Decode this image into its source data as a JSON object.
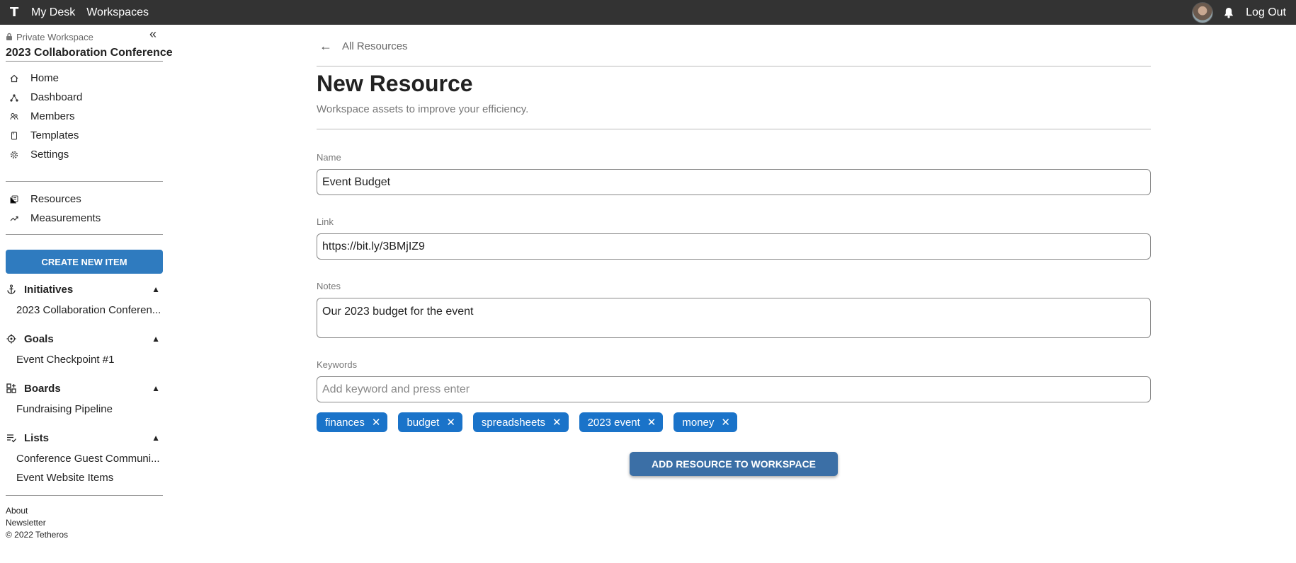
{
  "topbar": {
    "logo": "T",
    "nav": [
      "My Desk",
      "Workspaces"
    ],
    "logout": "Log Out"
  },
  "sidebar": {
    "private_label": "Private Workspace",
    "workspace_title": "2023 Collaboration Conference",
    "nav": [
      {
        "label": "Home",
        "icon": "home-icon"
      },
      {
        "label": "Dashboard",
        "icon": "dashboard-icon"
      },
      {
        "label": "Members",
        "icon": "members-icon"
      },
      {
        "label": "Templates",
        "icon": "templates-icon"
      },
      {
        "label": "Settings",
        "icon": "settings-icon"
      }
    ],
    "nav2": [
      {
        "label": "Resources",
        "icon": "resources-icon"
      },
      {
        "label": "Measurements",
        "icon": "measurements-icon"
      }
    ],
    "create_button": "CREATE NEW ITEM",
    "sections": [
      {
        "title": "Initiatives",
        "items": [
          "2023 Collaboration Conferen..."
        ]
      },
      {
        "title": "Goals",
        "items": [
          "Event Checkpoint #1"
        ]
      },
      {
        "title": "Boards",
        "items": [
          "Fundraising Pipeline"
        ]
      },
      {
        "title": "Lists",
        "items": [
          "Conference Guest Communi...",
          "Event Website Items"
        ]
      }
    ],
    "footer": [
      "About",
      "Newsletter",
      "© 2022 Tetheros"
    ]
  },
  "main": {
    "back_label": "All Resources",
    "title": "New Resource",
    "subtitle": "Workspace assets to improve your efficiency.",
    "fields": {
      "name_label": "Name",
      "name_value": "Event Budget",
      "link_label": "Link",
      "link_value": "https://bit.ly/3BMjIZ9",
      "notes_label": "Notes",
      "notes_value": "Our 2023 budget for the event",
      "keywords_label": "Keywords",
      "keywords_placeholder": "Add keyword and press enter"
    },
    "keywords": [
      "finances",
      "budget",
      "spreadsheets",
      "2023 event",
      "money"
    ],
    "submit_label": "ADD RESOURCE TO WORKSPACE"
  },
  "colors": {
    "topbar": "#333333",
    "create_button": "#2f7bbf",
    "chip": "#1a73c9",
    "submit": "#3b6fa6"
  }
}
